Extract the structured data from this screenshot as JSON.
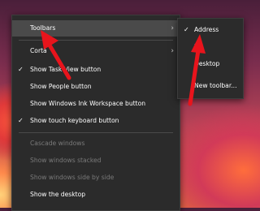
{
  "context_menu": {
    "toolbars_label": "Toolbars",
    "cortana_label": "Corta",
    "show_task_view_label": "Show Task View button",
    "show_people_label": "Show People button",
    "show_ink_label": "Show Windows Ink Workspace button",
    "show_keyboard_label": "Show touch keyboard button",
    "cascade_label": "Cascade windows",
    "stacked_label": "Show windows stacked",
    "side_by_side_label": "Show windows side by side",
    "show_desktop_label": "Show the desktop",
    "chevron_glyph": "›",
    "check_glyph": "✓"
  },
  "toolbars_submenu": {
    "address_label": "Address",
    "links_label": "L",
    "desktop_label": "Desktop",
    "new_toolbar_label": "New toolbar..."
  },
  "colors": {
    "menu_bg": "#2b2b2b",
    "hover_bg": "#4a4a4a",
    "disabled_text": "#7a7a7a",
    "arrow": "#e8141c"
  },
  "icons": {
    "chevron": "chevron-right-icon",
    "check": "checkmark-icon",
    "arrow": "red-arrow-annotation"
  }
}
